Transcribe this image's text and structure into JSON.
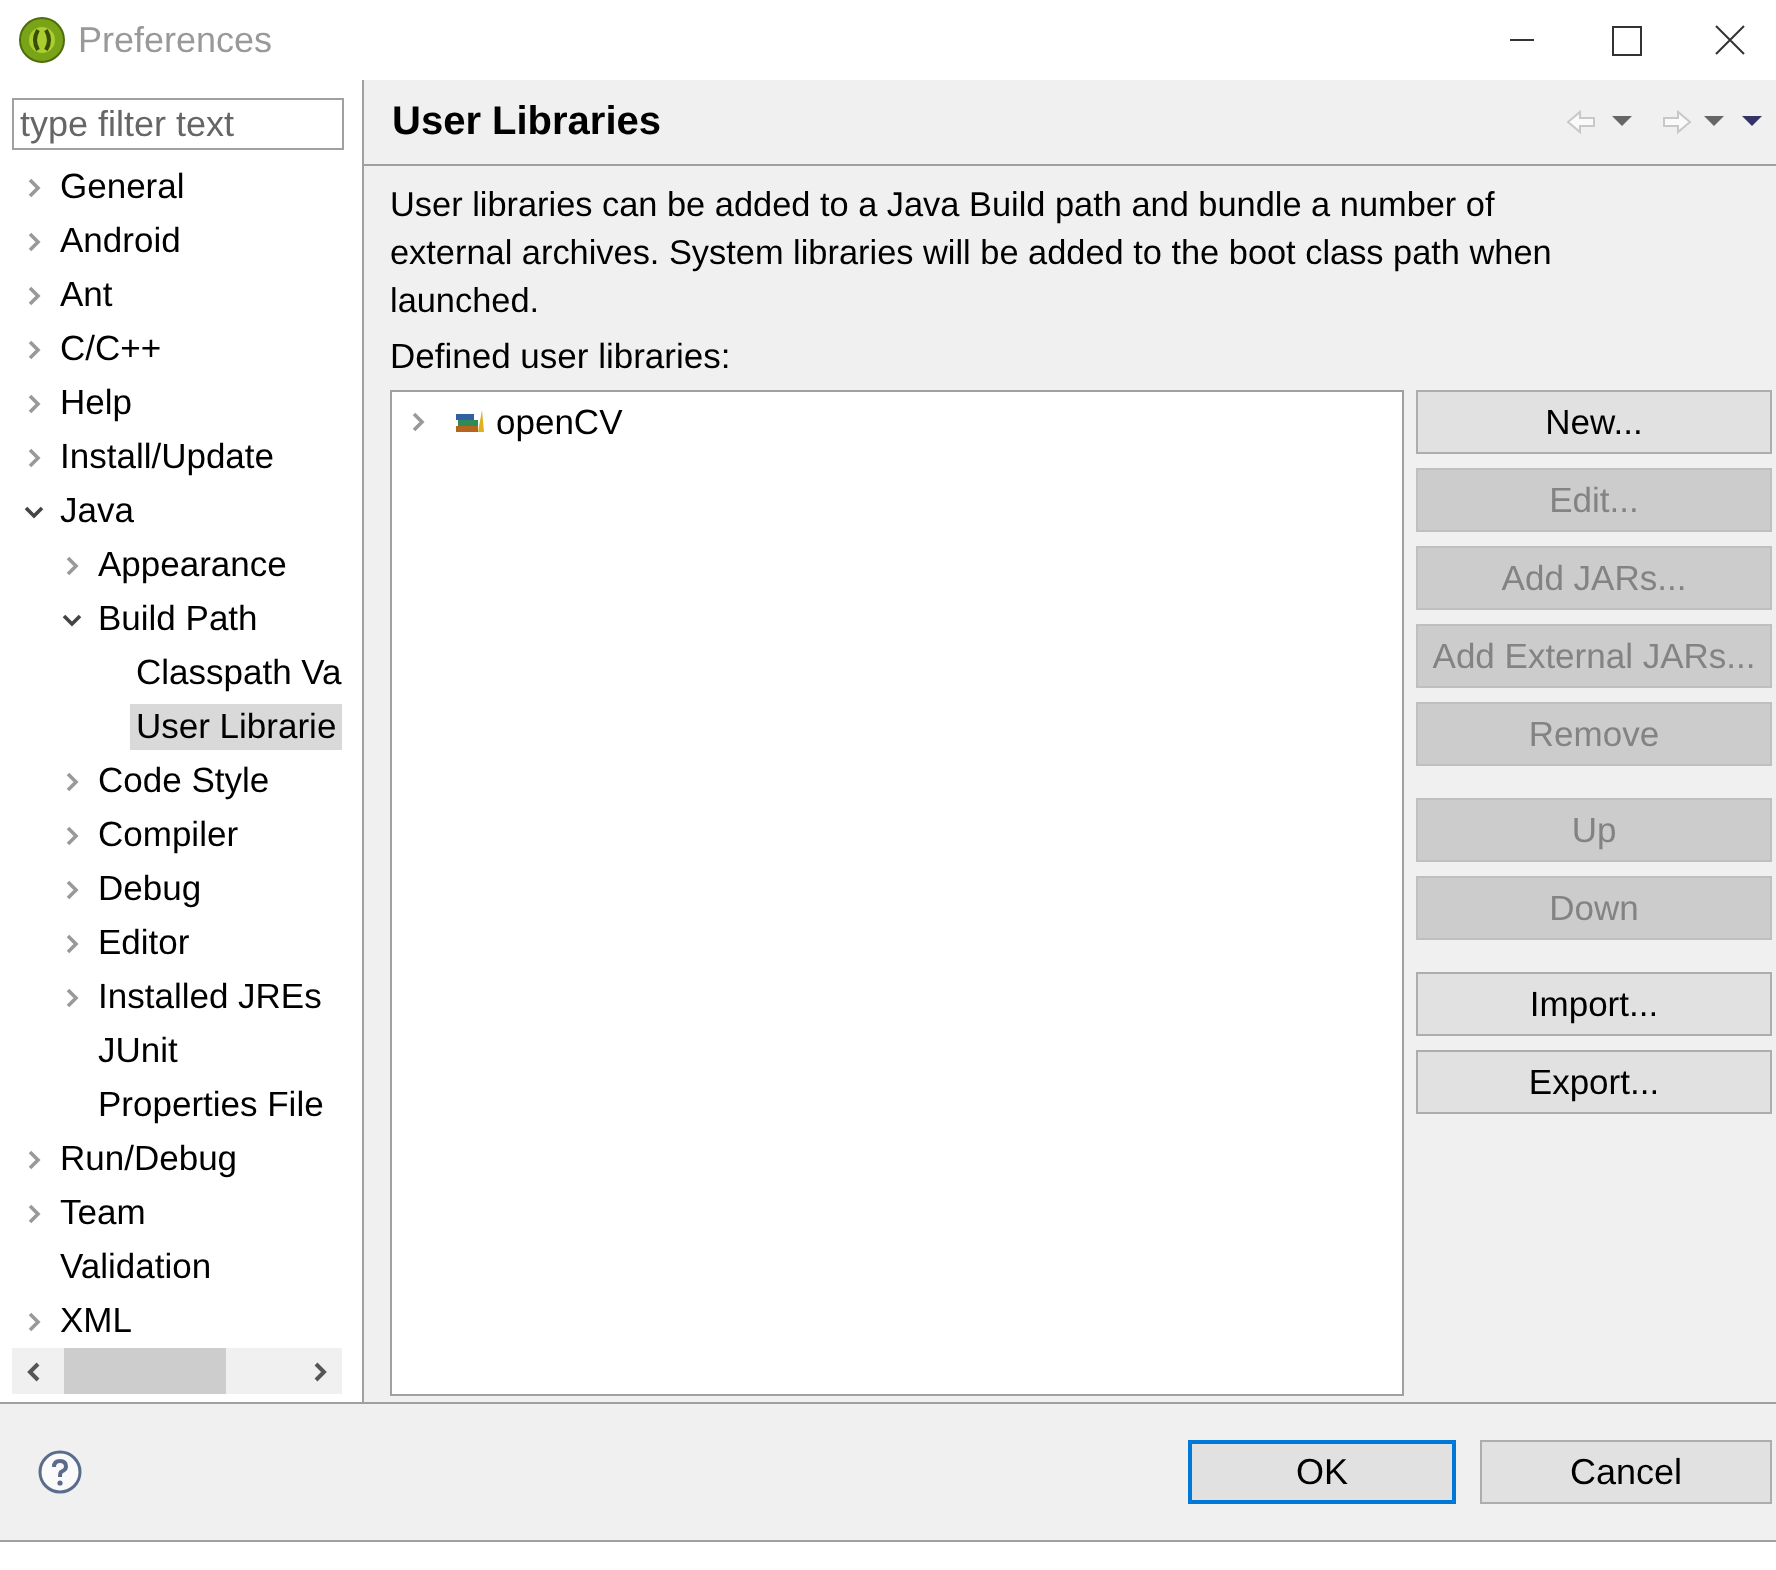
{
  "window": {
    "title": "Preferences"
  },
  "filter": {
    "placeholder": "type filter text"
  },
  "tree": [
    {
      "label": "General",
      "expanded": false,
      "selected": false
    },
    {
      "label": "Android",
      "expanded": false,
      "selected": false
    },
    {
      "label": "Ant",
      "expanded": false,
      "selected": false
    },
    {
      "label": "C/C++",
      "expanded": false,
      "selected": false
    },
    {
      "label": "Help",
      "expanded": false,
      "selected": false
    },
    {
      "label": "Install/Update",
      "expanded": false,
      "selected": false
    },
    {
      "label": "Java",
      "expanded": true,
      "selected": false,
      "children": [
        {
          "label": "Appearance",
          "expanded": false,
          "selected": false
        },
        {
          "label": "Build Path",
          "expanded": true,
          "selected": false,
          "children": [
            {
              "label": "Classpath Va",
              "selected": false
            },
            {
              "label": "User Librarie",
              "selected": true
            }
          ]
        },
        {
          "label": "Code Style",
          "expanded": false,
          "selected": false
        },
        {
          "label": "Compiler",
          "expanded": false,
          "selected": false
        },
        {
          "label": "Debug",
          "expanded": false,
          "selected": false
        },
        {
          "label": "Editor",
          "expanded": false,
          "selected": false
        },
        {
          "label": "Installed JREs",
          "expanded": false,
          "selected": false
        },
        {
          "label": "JUnit",
          "selected": false
        },
        {
          "label": "Properties File",
          "selected": false
        }
      ]
    },
    {
      "label": "Run/Debug",
      "expanded": false,
      "selected": false
    },
    {
      "label": "Team",
      "expanded": false,
      "selected": false
    },
    {
      "label": "Validation",
      "selected": false
    },
    {
      "label": "XML",
      "expanded": false,
      "selected": false
    }
  ],
  "page": {
    "title": "User Libraries",
    "description": "User libraries can be added to a Java Build path and bundle a number of external archives. System libraries will be added to the boot class path when launched.",
    "list_label": "Defined user libraries:",
    "libraries": [
      {
        "name": "openCV",
        "expanded": false
      }
    ],
    "button_groups": [
      [
        {
          "label": "New...",
          "disabled": false
        },
        {
          "label": "Edit...",
          "disabled": true
        },
        {
          "label": "Add JARs...",
          "disabled": true
        },
        {
          "label": "Add External JARs...",
          "disabled": true
        },
        {
          "label": "Remove",
          "disabled": true
        }
      ],
      [
        {
          "label": "Up",
          "disabled": true
        },
        {
          "label": "Down",
          "disabled": true
        }
      ],
      [
        {
          "label": "Import...",
          "disabled": false
        },
        {
          "label": "Export...",
          "disabled": false
        }
      ]
    ]
  },
  "footer": {
    "buttons": [
      {
        "label": "OK",
        "default": true
      },
      {
        "label": "Cancel",
        "default": false
      }
    ]
  }
}
